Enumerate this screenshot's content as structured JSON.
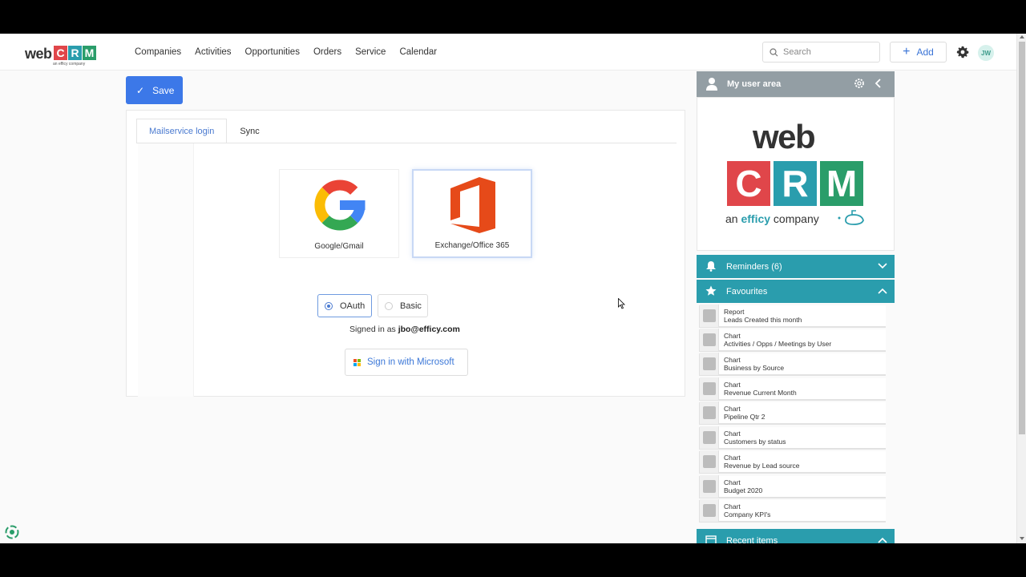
{
  "brand": {
    "web": "web",
    "letters": [
      "C",
      "R",
      "M"
    ],
    "tagline": "an efficy company",
    "colors": {
      "c": "#e0464a",
      "r": "#2a9dad",
      "m": "#2a9d6a"
    }
  },
  "nav": {
    "items": [
      "Companies",
      "Activities",
      "Opportunities",
      "Orders",
      "Service",
      "Calendar"
    ]
  },
  "header": {
    "search_placeholder": "Search",
    "add_label": "Add",
    "avatar_initials": "JW"
  },
  "toolbar": {
    "save_label": "Save"
  },
  "tabs": [
    "Mailservice login",
    "Sync"
  ],
  "providers": [
    {
      "label": "Google/Gmail",
      "icon": "google-icon"
    },
    {
      "label": "Exchange/Office 365",
      "icon": "office-icon"
    }
  ],
  "auth": {
    "options": [
      "OAuth",
      "Basic"
    ],
    "selected": "OAuth"
  },
  "signin": {
    "prefix": "Signed in as",
    "email": "jbo@efficy.com",
    "button": "Sign in with Microsoft"
  },
  "panel": {
    "title": "My user area",
    "big_logo": {
      "web": "web",
      "letters": [
        "C",
        "R",
        "M"
      ],
      "an": "an ",
      "efficy": "efficy",
      "company": " company"
    },
    "reminders": "Reminders (6)",
    "favourites": "Favourites",
    "recent": "Recent items",
    "fav_items": [
      {
        "type": "Report",
        "name": "Leads Created this month"
      },
      {
        "type": "Chart",
        "name": "Activities / Opps / Meetings by User"
      },
      {
        "type": "Chart",
        "name": "Business by Source"
      },
      {
        "type": "Chart",
        "name": "Revenue Current Month"
      },
      {
        "type": "Chart",
        "name": "Pipeline Qtr 2"
      },
      {
        "type": "Chart",
        "name": "Customers by status"
      },
      {
        "type": "Chart",
        "name": "Revenue by Lead source"
      },
      {
        "type": "Chart",
        "name": "Budget 2020"
      },
      {
        "type": "Chart",
        "name": "Company KPI's"
      }
    ]
  }
}
